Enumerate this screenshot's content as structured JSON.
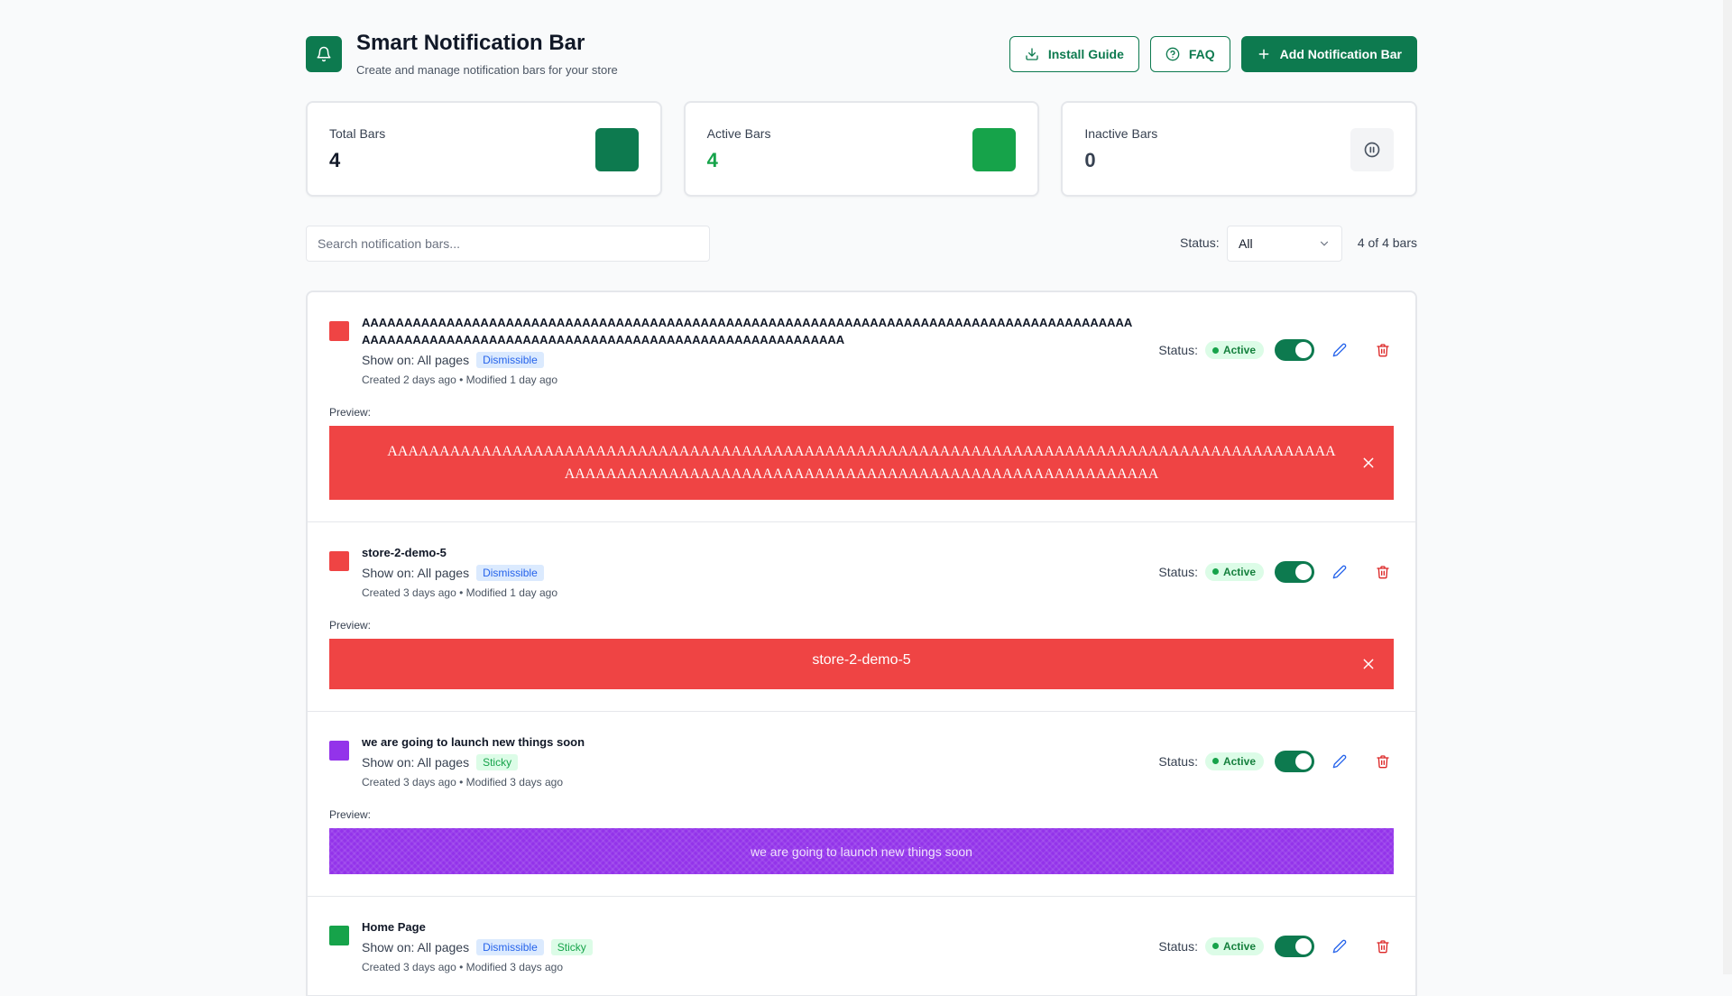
{
  "header": {
    "title": "Smart Notification Bar",
    "subtitle": "Create and manage notification bars for your store",
    "logo_icon": "bell-icon",
    "install_label": "Install Guide",
    "faq_label": "FAQ",
    "add_label": "Add Notification Bar"
  },
  "stats": {
    "total": {
      "label": "Total Bars",
      "value": "4",
      "icon_color": "#0d7a4f"
    },
    "active": {
      "label": "Active Bars",
      "value": "4",
      "icon_color": "#16a34a"
    },
    "inactive": {
      "label": "Inactive Bars",
      "value": "0",
      "icon": "pause-icon"
    }
  },
  "filters": {
    "search_placeholder": "Search notification bars...",
    "status_label": "Status:",
    "status_value": "All",
    "count": "4 of 4 bars"
  },
  "items": [
    {
      "name": "AAAAAAAAAAAAAAAAAAAAAAAAAAAAAAAAAAAAAAAAAAAAAAAAAAAAAAAAAAAAAAAAAAAAAAAAAAAAAAAAAAAAAAAAAAAAAAAAAAAAAAAAAAAAAAAAAAAAAAAAAAAAAAAAAAAAAAAAAAAAAAAAAAAA",
      "color": "#ef4444",
      "show_on": "Show on: All pages",
      "tags": [
        "Dismissible"
      ],
      "meta": "Created 2 days ago • Modified 1 day ago",
      "status_label": "Status:",
      "status": "Active",
      "preview_label": "Preview:",
      "preview_text": "AAAAAAAAAAAAAAAAAAAAAAAAAAAAAAAAAAAAAAAAAAAAAAAAAAAAAAAAAAAAAAAAAAAAAAAAAAAAAAAAAAAAAAAAAAAAAAAAAAAAAAAAAAAAAAAAAAAAAAAAAAAAAAAAAAAAAAAAAAAAAAAAAAAA"
    },
    {
      "name": "store-2-demo-5",
      "color": "#ef4444",
      "show_on": "Show on: All pages",
      "tags": [
        "Dismissible"
      ],
      "meta": "Created 3 days ago • Modified 1 day ago",
      "status_label": "Status:",
      "status": "Active",
      "preview_label": "Preview:",
      "preview_text": "store-2-demo-5"
    },
    {
      "name": "we are going to launch new things soon",
      "color": "#9333ea",
      "show_on": "Show on: All pages",
      "tags": [
        "Sticky"
      ],
      "meta": "Created 3 days ago • Modified 3 days ago",
      "status_label": "Status:",
      "status": "Active",
      "preview_label": "Preview:",
      "preview_text": "we are going to launch new things soon"
    },
    {
      "name": "Home Page",
      "color": "#16a34a",
      "show_on": "Show on: All pages",
      "tags": [
        "Dismissible",
        "Sticky"
      ],
      "meta": "Created 3 days ago • Modified 3 days ago",
      "status_label": "Status:",
      "status": "Active"
    }
  ]
}
